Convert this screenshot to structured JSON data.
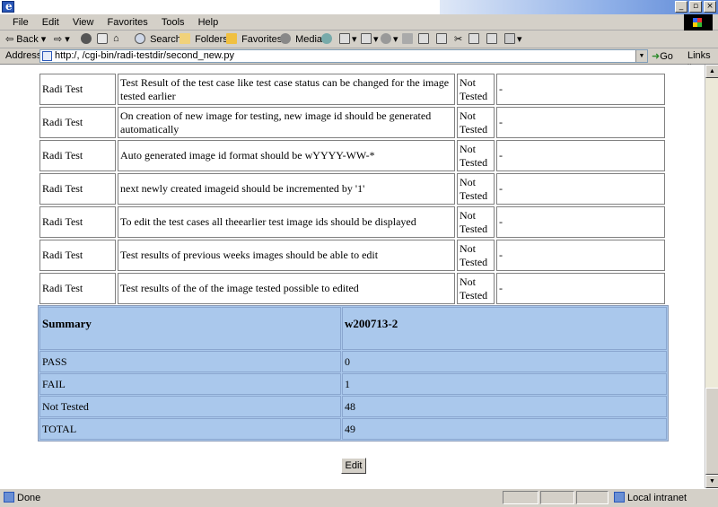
{
  "window": {
    "minimize_label": "_",
    "maximize_label": "▫",
    "close_label": "×"
  },
  "menu": [
    "File",
    "Edit",
    "View",
    "Favorites",
    "Tools",
    "Help"
  ],
  "toolbar": {
    "back": "Back",
    "search": "Search",
    "folders": "Folders",
    "favorites": "Favorites",
    "media": "Media"
  },
  "address": {
    "label": "Address",
    "url": "http:/,                /cgi-bin/radi-testdir/second_new.py",
    "go": "Go",
    "links": "Links"
  },
  "tests": [
    {
      "project": "Radi Test",
      "description": "Test Result of the test case like test case status can be changed for the image tested earlier",
      "status": "Not Tested",
      "comment": "-"
    },
    {
      "project": "Radi Test",
      "description": "On creation of new image for testing, new image id should be generated automatically",
      "status": "Not Tested",
      "comment": "-"
    },
    {
      "project": "Radi Test",
      "description": "Auto generated image id format should be wYYYY-WW-*",
      "status": "Not Tested",
      "comment": "-"
    },
    {
      "project": "Radi Test",
      "description": "next newly created imageid should be incremented by '1'",
      "status": "Not Tested",
      "comment": "-"
    },
    {
      "project": "Radi Test",
      "description": "To edit the test cases all theearlier test image ids should be displayed",
      "status": "Not Tested",
      "comment": "-"
    },
    {
      "project": "Radi Test",
      "description": "Test results of previous weeks images should be able to edit",
      "status": "Not Tested",
      "comment": "-"
    },
    {
      "project": "Radi Test",
      "description": "Test results of the of the image tested possible to edited",
      "status": "Not Tested",
      "comment": "-"
    }
  ],
  "summary": {
    "header_label": "Summary",
    "image_id": "w200713-2",
    "rows": [
      {
        "label": "PASS",
        "value": "0"
      },
      {
        "label": "FAIL",
        "value": "1"
      },
      {
        "label": "Not Tested",
        "value": "48"
      },
      {
        "label": "TOTAL",
        "value": "49"
      }
    ]
  },
  "edit_button": "Edit",
  "status": {
    "text": "Done",
    "zone": "Local intranet"
  }
}
